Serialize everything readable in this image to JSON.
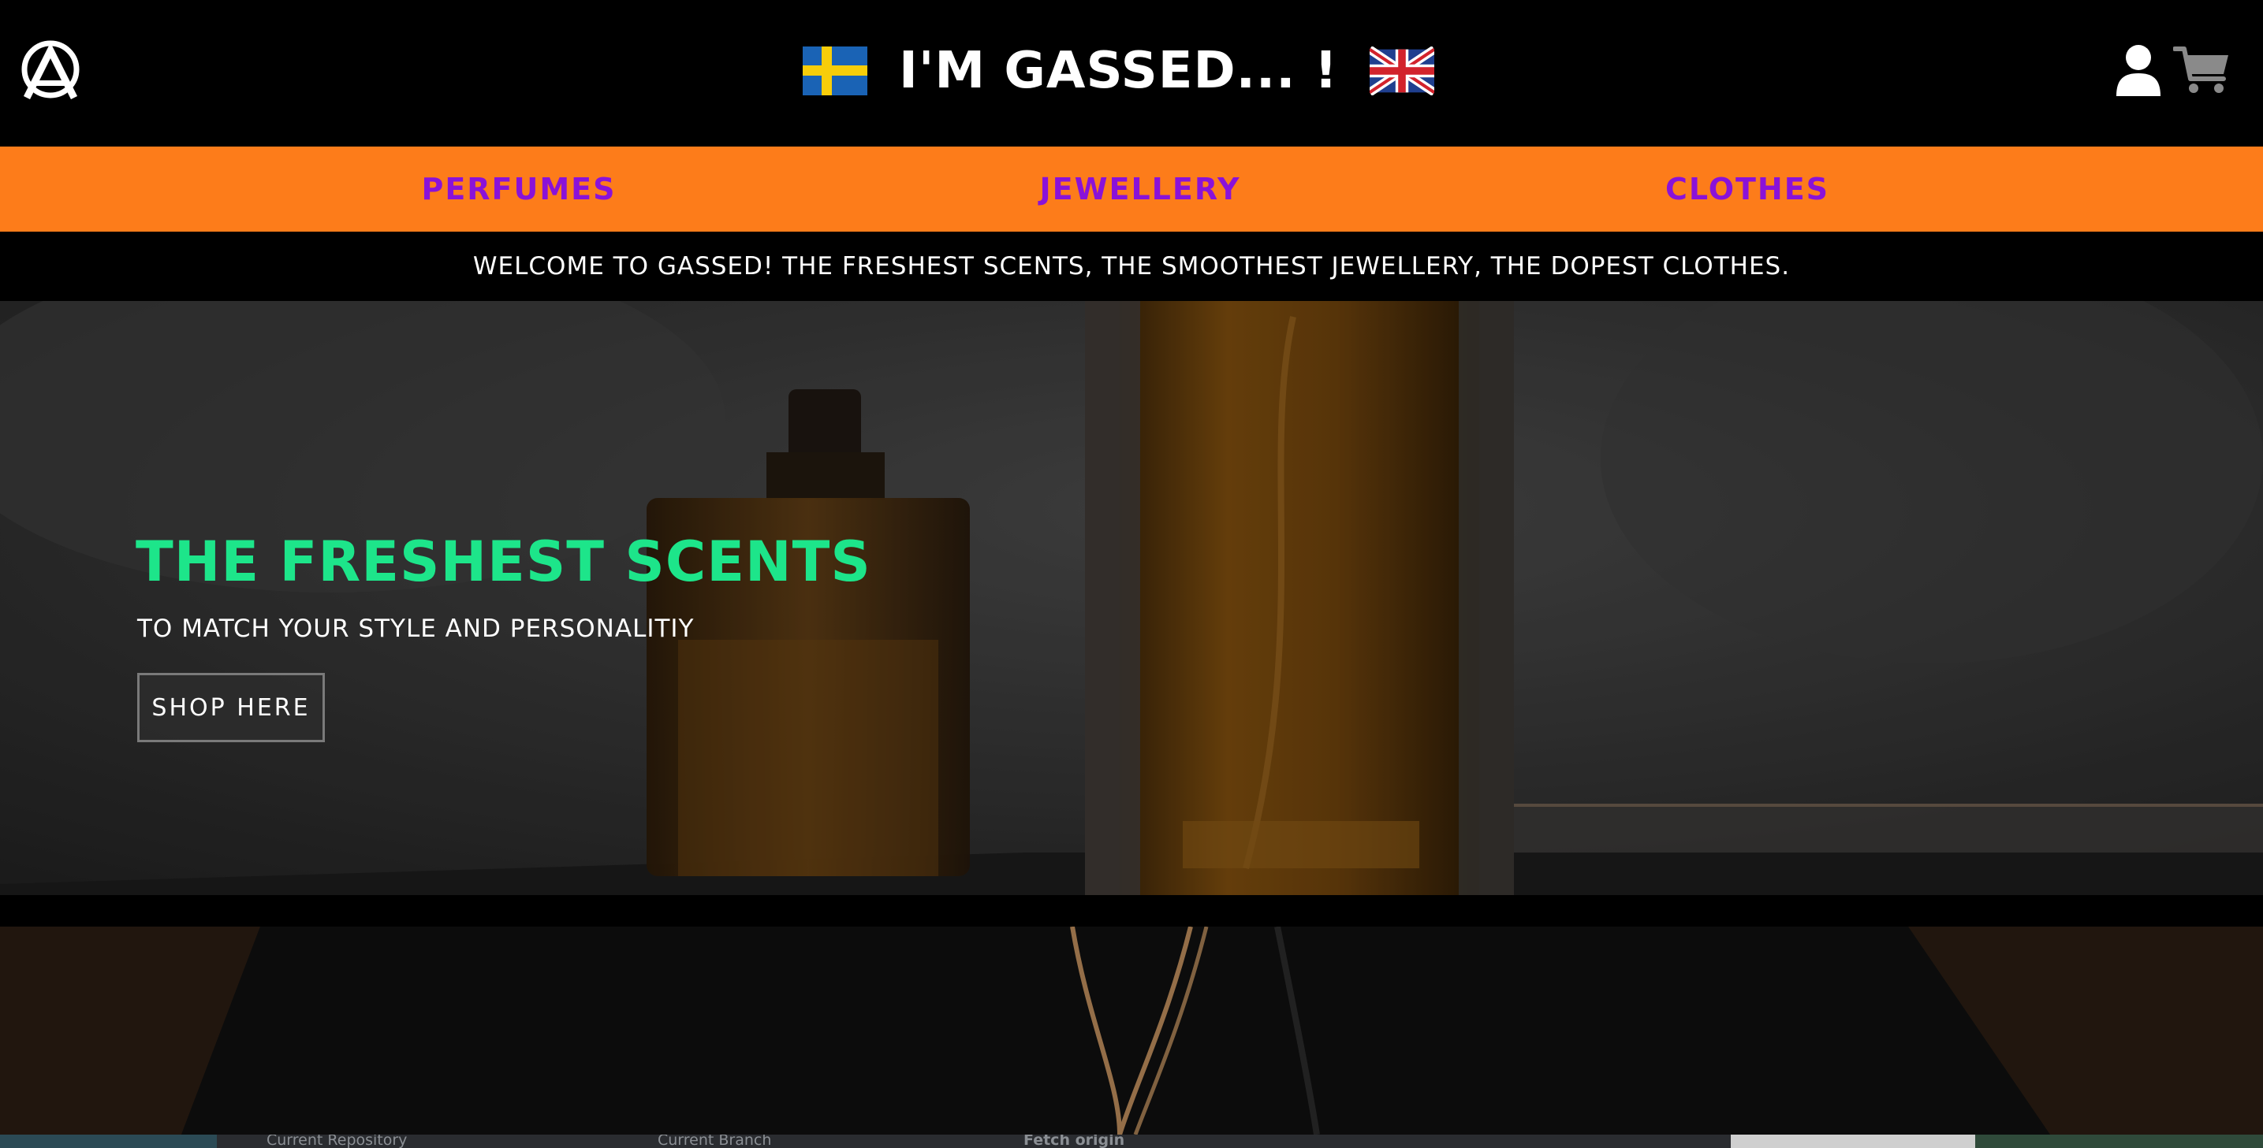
{
  "header": {
    "title": "I'M GASSED... !",
    "icons": {
      "logo": "brand-logo-icon",
      "left_flag": "sweden-flag-icon",
      "right_flag": "uk-flag-icon",
      "account": "user-icon",
      "cart": "cart-icon"
    }
  },
  "nav": {
    "items": [
      {
        "label": "PERFUMES"
      },
      {
        "label": "JEWELLERY"
      },
      {
        "label": "CLOTHES"
      }
    ]
  },
  "welcome": {
    "text": "WELCOME TO GASSED! THE FRESHEST SCENTS, THE SMOOTHEST JEWELLERY, THE DOPEST CLOTHES."
  },
  "hero": {
    "title": "THE FRESHEST SCENTS",
    "subtitle": "TO MATCH YOUR STYLE AND PERSONALITIY",
    "button": "SHOP HERE"
  },
  "bottom_strip": {
    "current_repository": "Current Repository",
    "current_branch": "Current Branch",
    "fetch_origin": "Fetch origin"
  },
  "colors": {
    "nav_bg": "#fd7c1a",
    "nav_text": "#8a12d8",
    "hero_title": "#1de58a",
    "background": "#000000"
  }
}
